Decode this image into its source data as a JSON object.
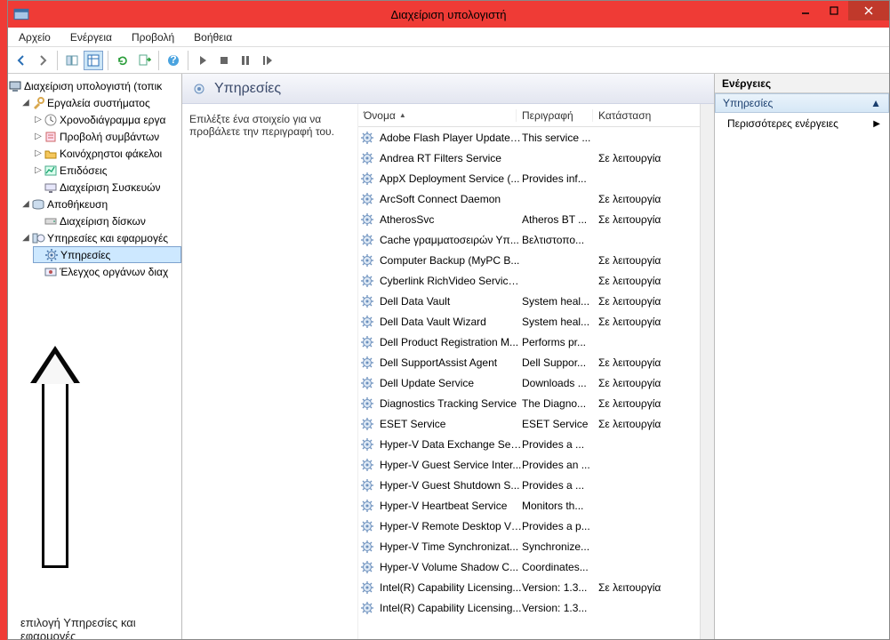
{
  "window": {
    "title": "Διαχείριση υπολογιστή"
  },
  "menu": {
    "file": "Αρχείο",
    "action": "Ενέργεια",
    "view": "Προβολή",
    "help": "Βοήθεια"
  },
  "tree": {
    "root": "Διαχείριση υπολογιστή (τοπικ",
    "systemTools": "Εργαλεία συστήματος",
    "taskScheduler": "Χρονοδιάγραμμα εργα",
    "eventViewer": "Προβολή συμβάντων",
    "sharedFolders": "Κοινόχρηστοι φάκελοι",
    "performance": "Επιδόσεις",
    "deviceManager": "Διαχείριση Συσκευών",
    "storage": "Αποθήκευση",
    "diskMgmt": "Διαχείριση δίσκων",
    "servicesApps": "Υπηρεσίες και εφαρμογές",
    "services": "Υπηρεσίες",
    "wmiControl": "Έλεγχος οργάνων διαχ"
  },
  "annotate": {
    "text": "επιλογή Υπηρεσίες και εφαρμογές"
  },
  "center": {
    "title": "Υπηρεσίες",
    "hint": "Επιλέξτε ένα στοιχείο για να προβάλετε την περιγραφή του.",
    "col_name": "Όνομα",
    "col_desc": "Περιγραφή",
    "col_status": "Κατάσταση"
  },
  "services": [
    {
      "name": "Adobe Flash Player Update ...",
      "desc": "This service ...",
      "status": ""
    },
    {
      "name": "Andrea RT Filters Service",
      "desc": "",
      "status": "Σε λειτουργία"
    },
    {
      "name": "AppX Deployment Service (...",
      "desc": "Provides inf...",
      "status": ""
    },
    {
      "name": "ArcSoft Connect Daemon",
      "desc": "",
      "status": "Σε λειτουργία"
    },
    {
      "name": "AtherosSvc",
      "desc": "Atheros BT ...",
      "status": "Σε λειτουργία"
    },
    {
      "name": "Cache γραμματοσειρών Υπ...",
      "desc": "Βελτιστοπο...",
      "status": ""
    },
    {
      "name": "Computer Backup (MyPC B...",
      "desc": "",
      "status": "Σε λειτουργία"
    },
    {
      "name": "Cyberlink RichVideo Service...",
      "desc": "",
      "status": "Σε λειτουργία"
    },
    {
      "name": "Dell Data Vault",
      "desc": "System heal...",
      "status": "Σε λειτουργία"
    },
    {
      "name": "Dell Data Vault Wizard",
      "desc": "System heal...",
      "status": "Σε λειτουργία"
    },
    {
      "name": "Dell Product Registration M...",
      "desc": "Performs pr...",
      "status": ""
    },
    {
      "name": "Dell SupportAssist Agent",
      "desc": "Dell Suppor...",
      "status": "Σε λειτουργία"
    },
    {
      "name": "Dell Update Service",
      "desc": "Downloads ...",
      "status": "Σε λειτουργία"
    },
    {
      "name": "Diagnostics Tracking Service",
      "desc": "The Diagno...",
      "status": "Σε λειτουργία"
    },
    {
      "name": "ESET Service",
      "desc": "ESET Service",
      "status": "Σε λειτουργία"
    },
    {
      "name": "Hyper-V Data Exchange Ser...",
      "desc": "Provides a ...",
      "status": ""
    },
    {
      "name": "Hyper-V Guest Service Inter...",
      "desc": "Provides an ...",
      "status": ""
    },
    {
      "name": "Hyper-V Guest Shutdown S...",
      "desc": "Provides a ...",
      "status": ""
    },
    {
      "name": "Hyper-V Heartbeat Service",
      "desc": "Monitors th...",
      "status": ""
    },
    {
      "name": "Hyper-V Remote Desktop Vi...",
      "desc": "Provides a p...",
      "status": ""
    },
    {
      "name": "Hyper-V Time Synchronizat...",
      "desc": "Synchronize...",
      "status": ""
    },
    {
      "name": "Hyper-V Volume Shadow C...",
      "desc": "Coordinates...",
      "status": ""
    },
    {
      "name": "Intel(R) Capability Licensing...",
      "desc": "Version: 1.3...",
      "status": "Σε λειτουργία"
    },
    {
      "name": "Intel(R) Capability Licensing...",
      "desc": "Version: 1.3...",
      "status": ""
    }
  ],
  "actions": {
    "header": "Ενέργειες",
    "group": "Υπηρεσίες",
    "more": "Περισσότερες ενέργειες"
  }
}
